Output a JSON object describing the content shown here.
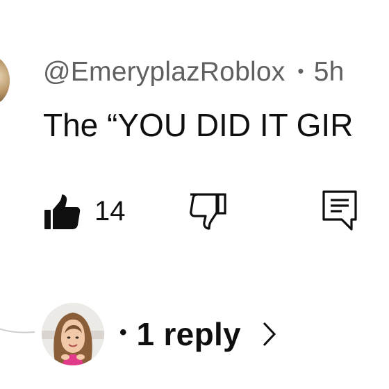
{
  "comment": {
    "author_handle": "@EmeryplazRoblox",
    "separator": "•",
    "time_ago": "5h",
    "text": "The “YOU DID IT GIR"
  },
  "actions": {
    "like_icon": "thumbs-up-filled-icon",
    "like_count": "14",
    "dislike_icon": "thumbs-down-outline-icon",
    "reply_icon": "comment-reply-icon"
  },
  "replies": {
    "separator": "•",
    "label": "1 reply",
    "chevron_icon": "chevron-right-icon"
  }
}
